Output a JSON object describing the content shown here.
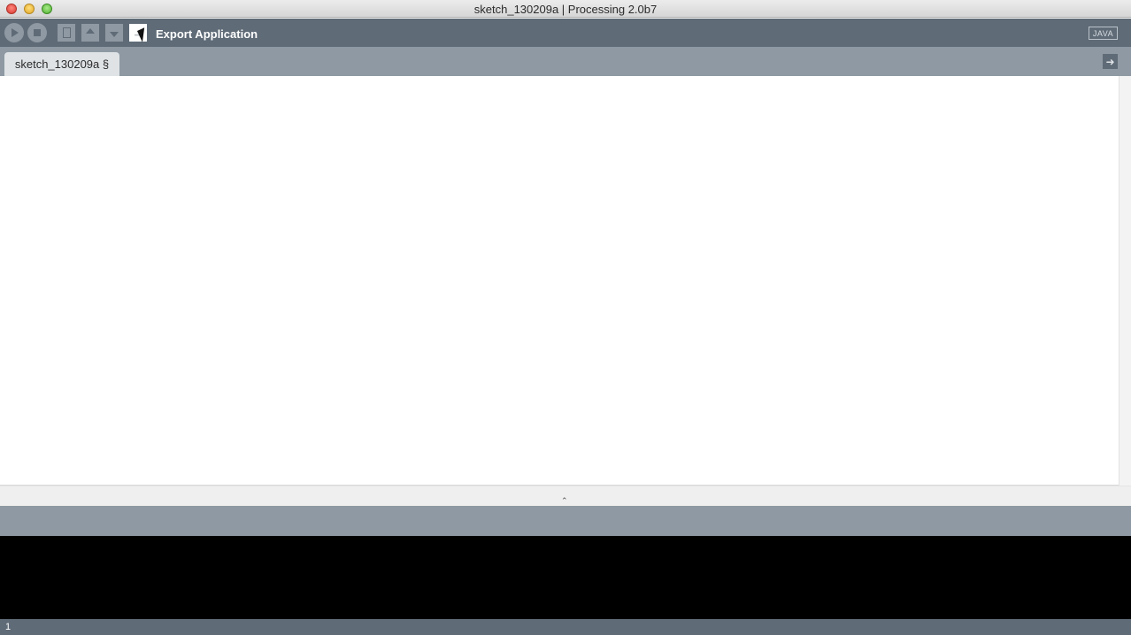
{
  "window": {
    "title": "sketch_130209a | Processing 2.0b7"
  },
  "toolbar": {
    "buttons": [
      {
        "name": "run",
        "icon": "play-icon"
      },
      {
        "name": "stop",
        "icon": "stop-icon"
      },
      {
        "name": "new",
        "icon": "new-document-icon"
      },
      {
        "name": "open",
        "icon": "arrow-up-icon"
      },
      {
        "name": "save",
        "icon": "arrow-down-icon"
      },
      {
        "name": "export",
        "icon": "export-arrow-icon"
      }
    ],
    "hover_label": "Export Application",
    "mode": "JAVA"
  },
  "tabs": [
    {
      "label": "sketch_130209a §"
    }
  ],
  "status": {
    "line_number": "1"
  }
}
